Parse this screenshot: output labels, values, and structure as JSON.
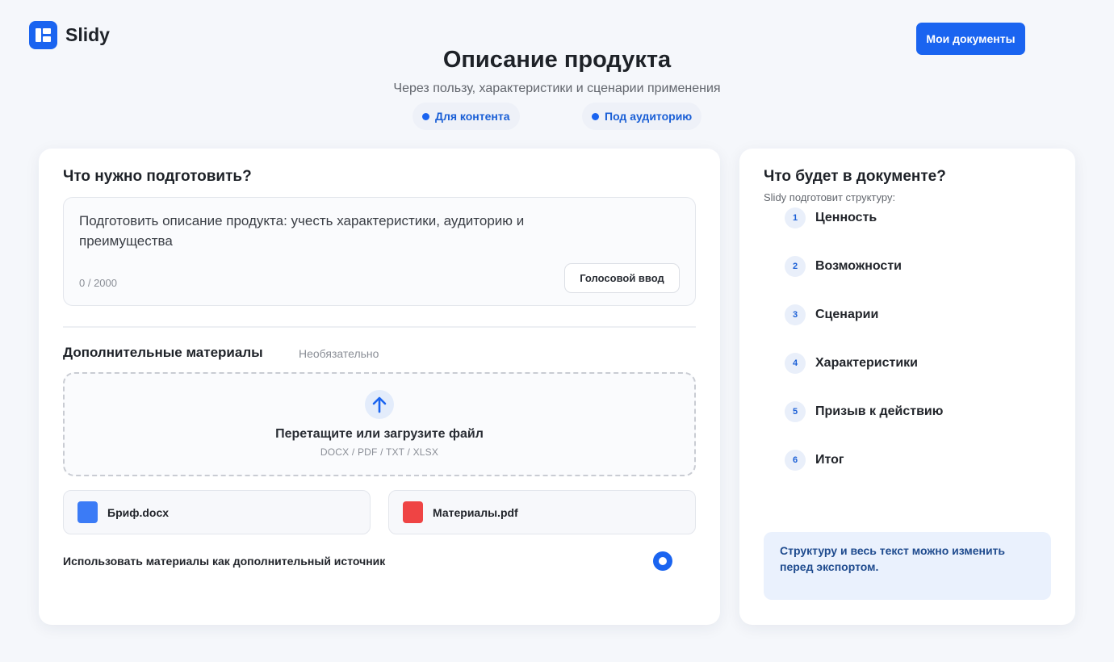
{
  "app": {
    "name": "Slidy"
  },
  "header": {
    "my_documents_label": "Мои документы"
  },
  "page": {
    "title": "Описание продукта",
    "subtitle": "Через пользу, характеристики и сценарии применения",
    "chips": [
      "Для контента",
      "Под аудиторию"
    ]
  },
  "prompt": {
    "title": "Что нужно подготовить?",
    "text": "Подготовить описание продукта: учесть характеристики, аудиторию и преимущества",
    "counter": "0 / 2000",
    "voice_label": "Голосовой ввод"
  },
  "materials": {
    "title": "Дополнительные материалы",
    "optional": "Необязательно",
    "dropzone_title": "Перетащите или загрузите файл",
    "dropzone_formats": "DOCX / PDF / TXT / XLSX",
    "files": [
      {
        "name": "Бриф.docx",
        "color": "#3b7bf6"
      },
      {
        "name": "Материалы.pdf",
        "color": "#ef4444"
      }
    ],
    "use_as_source_label": "Использовать материалы как дополнительный источник",
    "use_as_source": true
  },
  "outline": {
    "title": "Что будет в документе?",
    "subtitle": "Slidy подготовит структуру:",
    "steps": [
      {
        "num": "1",
        "label": "Ценность"
      },
      {
        "num": "2",
        "label": "Возможности"
      },
      {
        "num": "3",
        "label": "Сценарии"
      },
      {
        "num": "4",
        "label": "Характеристики"
      },
      {
        "num": "5",
        "label": "Призыв к действию"
      },
      {
        "num": "6",
        "label": "Итог"
      }
    ],
    "note": "Структуру и весь текст можно изменить перед экспортом."
  },
  "colors": {
    "accent": "#1a64f0",
    "background": "#f5f7fb"
  }
}
